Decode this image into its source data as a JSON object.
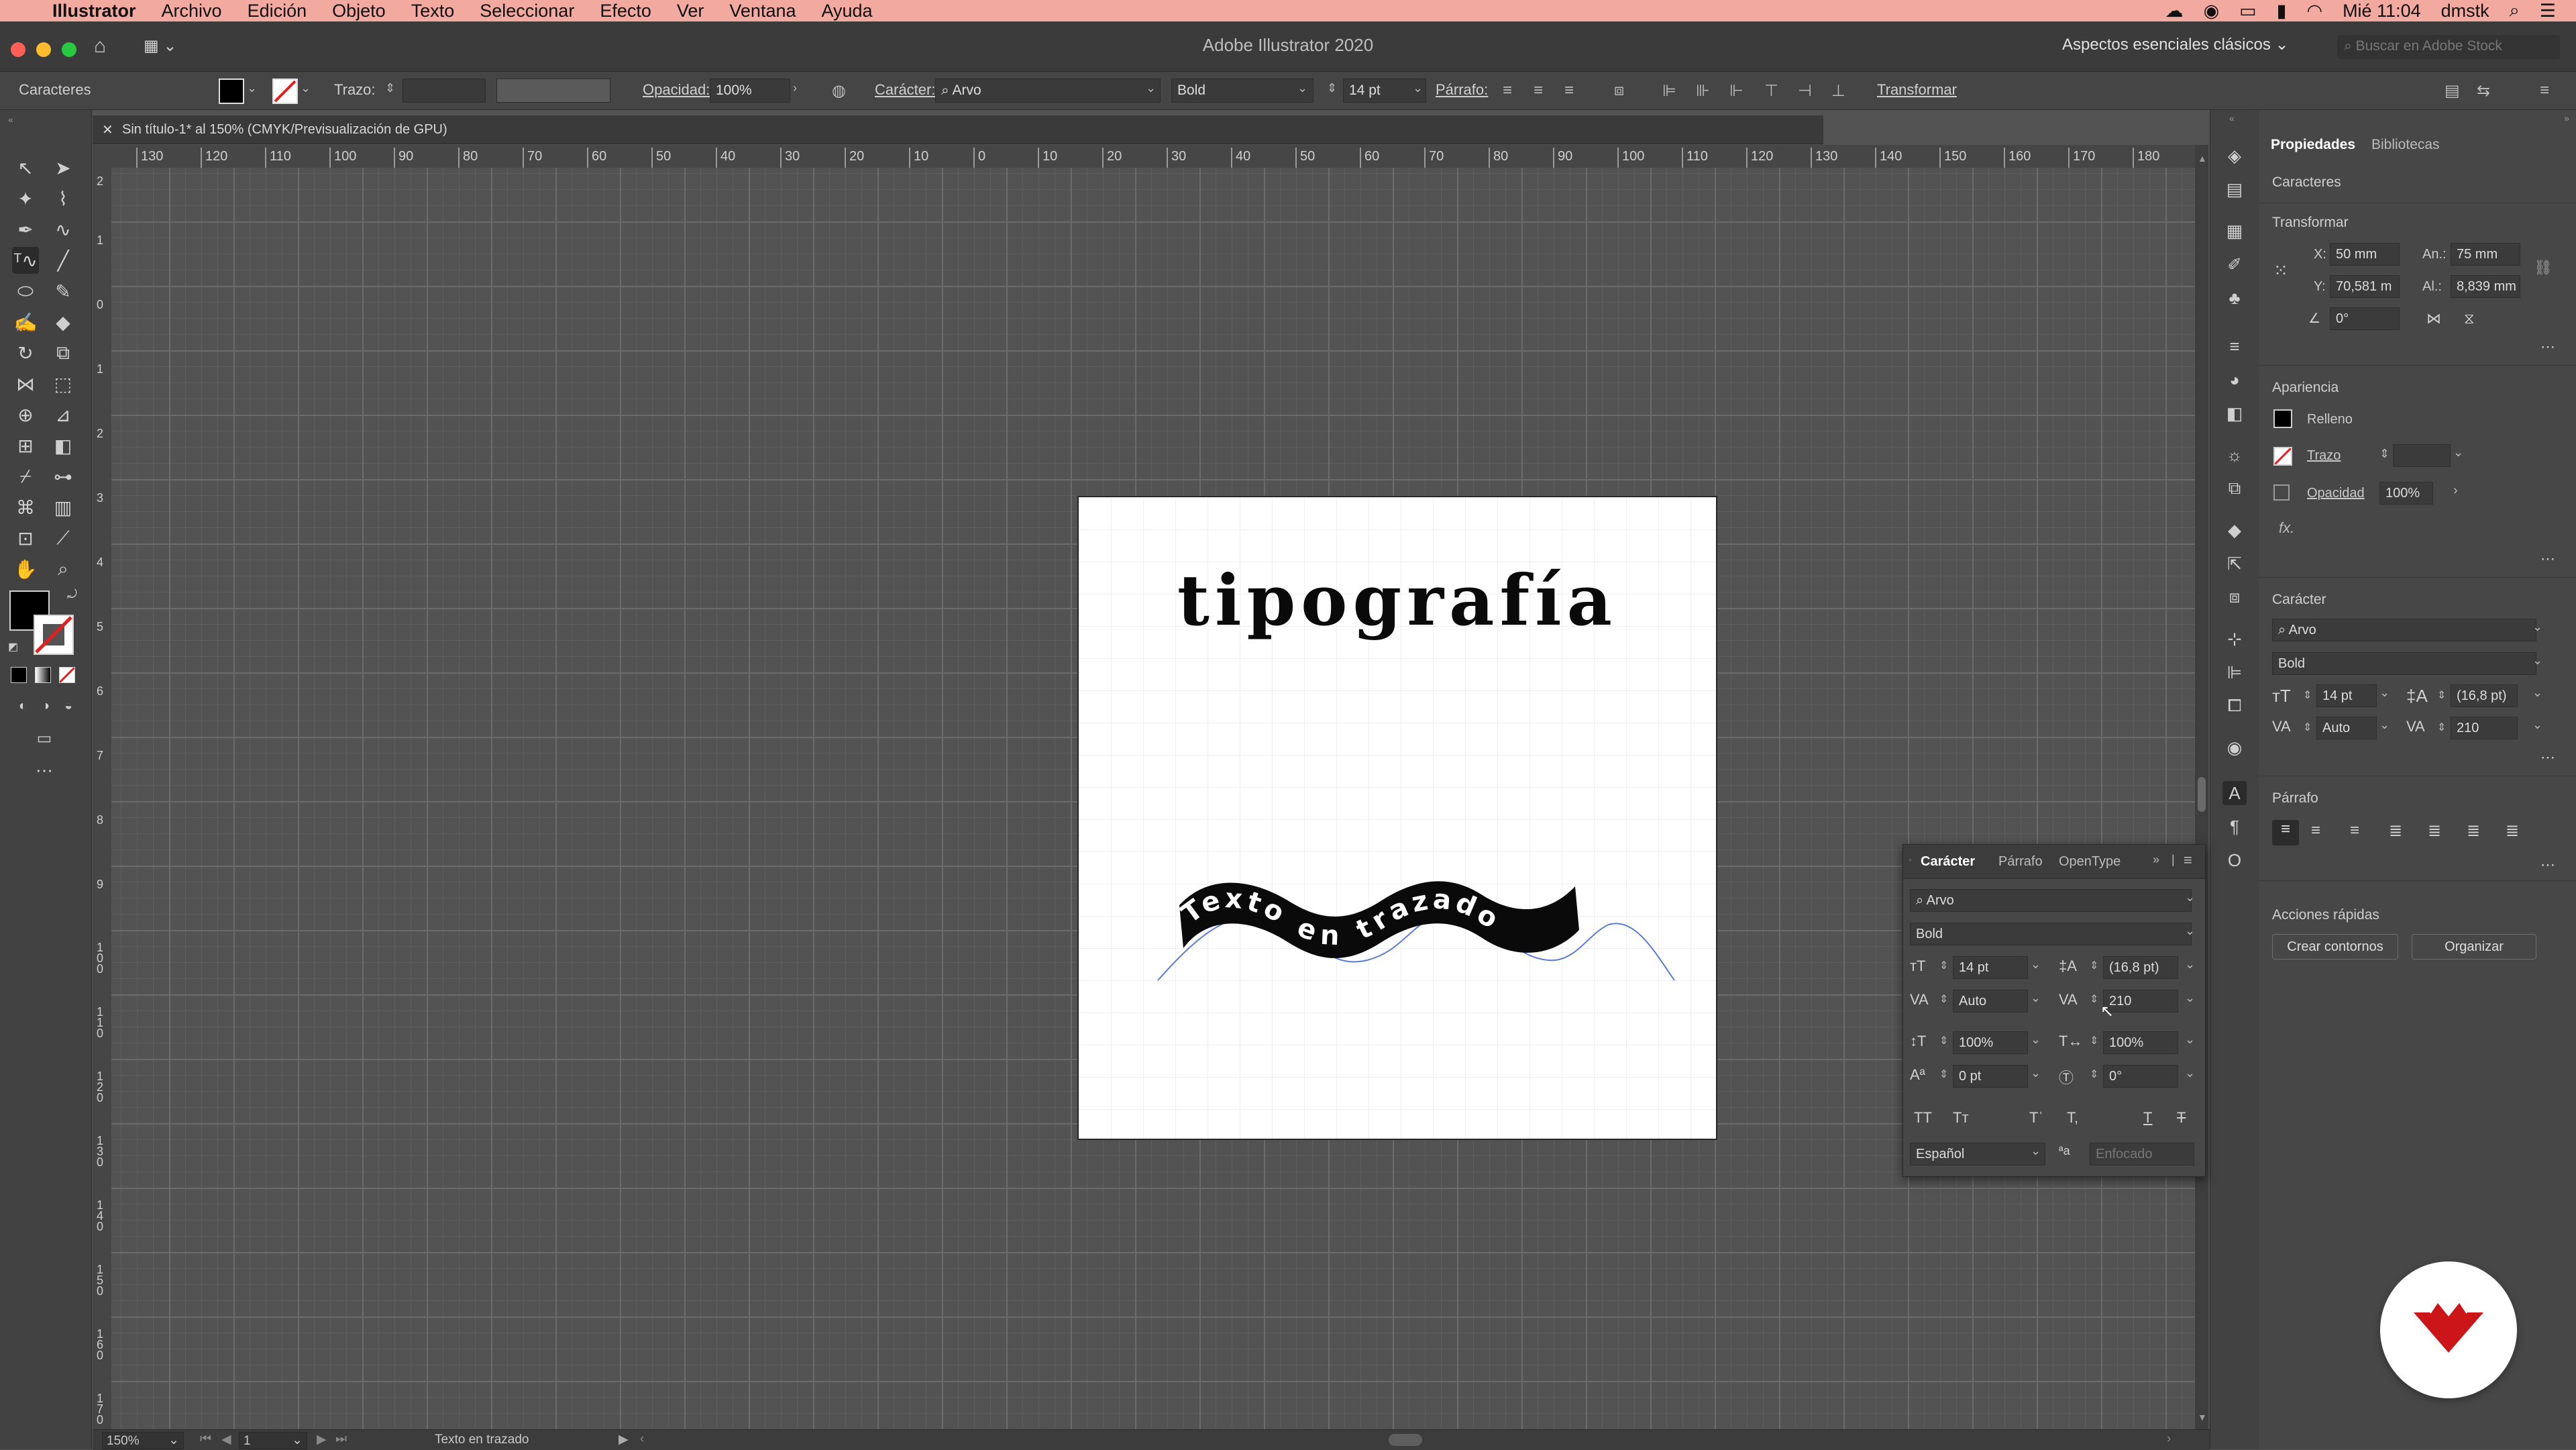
{
  "menubar": {
    "app": "Illustrator",
    "items": [
      "Archivo",
      "Edición",
      "Objeto",
      "Texto",
      "Seleccionar",
      "Efecto",
      "Ver",
      "Ventana",
      "Ayuda"
    ],
    "clock": "Mié 11:04",
    "user": "dmstk"
  },
  "window": {
    "title": "Adobe Illustrator 2020",
    "workspace": "Aspectos esenciales clásicos",
    "stock_search_placeholder": "Buscar en Adobe Stock"
  },
  "controlbar": {
    "label": "Caracteres",
    "stroke_label": "Trazo:",
    "opacity_label": "Opacidad:",
    "opacity_value": "100%",
    "character_label": "Carácter:",
    "font": "Arvo",
    "style": "Bold",
    "size": "14 pt",
    "paragraph_label": "Párrafo:",
    "transform_label": "Transformar"
  },
  "document": {
    "tab_title": "Sin título-1* al 150% (CMYK/Previsualización de GPU)"
  },
  "rulers": {
    "horizontal": [
      "130",
      "120",
      "110",
      "100",
      "90",
      "80",
      "70",
      "60",
      "50",
      "40",
      "30",
      "20",
      "10",
      "0",
      "10",
      "20",
      "30",
      "40",
      "50",
      "60",
      "70",
      "80",
      "90",
      "100",
      "110",
      "120",
      "130",
      "140",
      "150",
      "160",
      "170",
      "180"
    ],
    "vertical": [
      "2",
      "1",
      "0",
      "1",
      "2",
      "3",
      "4",
      "5",
      "6",
      "7",
      "8",
      "9",
      "100",
      "110",
      "120",
      "130",
      "140",
      "150",
      "160",
      "170",
      "180"
    ]
  },
  "artboard": {
    "heading": "tipografía",
    "path_text": "Texto en trazado"
  },
  "statusbar": {
    "zoom": "150%",
    "artboard_number": "1",
    "tool_status": "Texto en trazado"
  },
  "properties": {
    "tabs": [
      "Propiedades",
      "Bibliotecas"
    ],
    "selection_type": "Caracteres",
    "transform_title": "Transformar",
    "x_label": "X:",
    "x": "50 mm",
    "w_label": "An.:",
    "w": "75 mm",
    "y_label": "Y:",
    "y": "70,581 m",
    "h_label": "Al.:",
    "h": "8,839 mm",
    "angle": "0°",
    "appearance_title": "Apariencia",
    "fill_label": "Relleno",
    "stroke_label": "Trazo",
    "opacity_label": "Opacidad",
    "opacity": "100%",
    "fx": "fx.",
    "character_title": "Carácter",
    "font": "Arvo",
    "style": "Bold",
    "size": "14 pt",
    "leading": "(16,8 pt)",
    "kerning": "Auto",
    "tracking": "210",
    "paragraph_title": "Párrafo",
    "quick_actions_title": "Acciones rápidas",
    "btn_outlines": "Crear contornos",
    "btn_arrange": "Organizar"
  },
  "character_panel": {
    "tabs": [
      "Carácter",
      "Párrafo",
      "OpenType"
    ],
    "font": "Arvo",
    "style": "Bold",
    "size": "14 pt",
    "leading": "(16,8 pt)",
    "kerning": "Auto",
    "tracking": "210",
    "vscale": "100%",
    "hscale": "100%",
    "baseline": "0 pt",
    "rotation": "0°",
    "language": "Español",
    "antialias": "Enfocado"
  },
  "colors": {
    "menubar": "#f1a9a0",
    "logo_red": "#cc1518",
    "ui_dark": "#535353"
  }
}
